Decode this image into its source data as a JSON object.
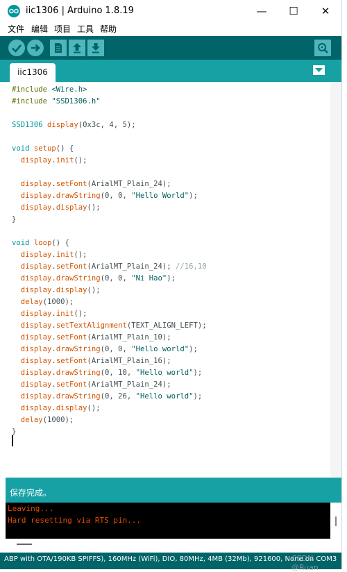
{
  "window": {
    "title": "iic1306 | Arduino 1.8.19",
    "minimize": "—",
    "maximize": "☐",
    "close": "✕"
  },
  "menu": [
    "文件",
    "编辑",
    "项目",
    "工具",
    "帮助"
  ],
  "toolbar": {
    "verify": "verify-icon",
    "upload": "upload-icon",
    "new": "new-file-icon",
    "open": "open-icon",
    "save": "save-icon",
    "serial_monitor": "serial-monitor-icon"
  },
  "tabs": [
    {
      "label": "iic1306"
    }
  ],
  "editor": {
    "lines": [
      "#include <Wire.h>",
      "#include \"SSD1306.h\"",
      "",
      "SSD1306 display(0x3c, 4, 5);",
      "",
      "void setup() {",
      "  display.init();",
      "",
      "  display.setFont(ArialMT_Plain_24);",
      "  display.drawString(0, 0, \"Hello World\");",
      "  display.display();",
      "}",
      "",
      "void loop() {",
      "  display.init();",
      "  display.setFont(ArialMT_Plain_24); //16,10",
      "  display.drawString(0, 0, \"Ni Hao\");",
      "  display.display();",
      "  delay(1000);",
      "  display.init();",
      "  display.setTextAlignment(TEXT_ALIGN_LEFT);",
      "  display.setFont(ArialMT_Plain_10);",
      "  display.drawString(0, 0, \"Hello world\");",
      "  display.setFont(ArialMT_Plain_16);",
      "  display.drawString(0, 10, \"Hello world\");",
      "  display.setFont(ArialMT_Plain_24);",
      "  display.drawString(0, 26, \"Hello world\");",
      "  display.display();",
      "  delay(1000);",
      "}"
    ]
  },
  "status": {
    "message": "保存完成。"
  },
  "console": {
    "lines": [
      "Leaving...",
      "Hard resetting via RTS pin..."
    ]
  },
  "board_info": "ABP with OTA/190KB SPIFFS), 160MHz (WiFi), DIO, 80MHz, 4MB (32Mb), 921600, None on COM3",
  "watermark": "CSDN @Ruan",
  "colors": {
    "toolbar_bg": "#006468",
    "tab_bar_bg": "#17a1a5",
    "button_bg": "#4db7bb",
    "console_text": "#e34c00",
    "keyword": "#00979c",
    "function": "#d35400"
  }
}
